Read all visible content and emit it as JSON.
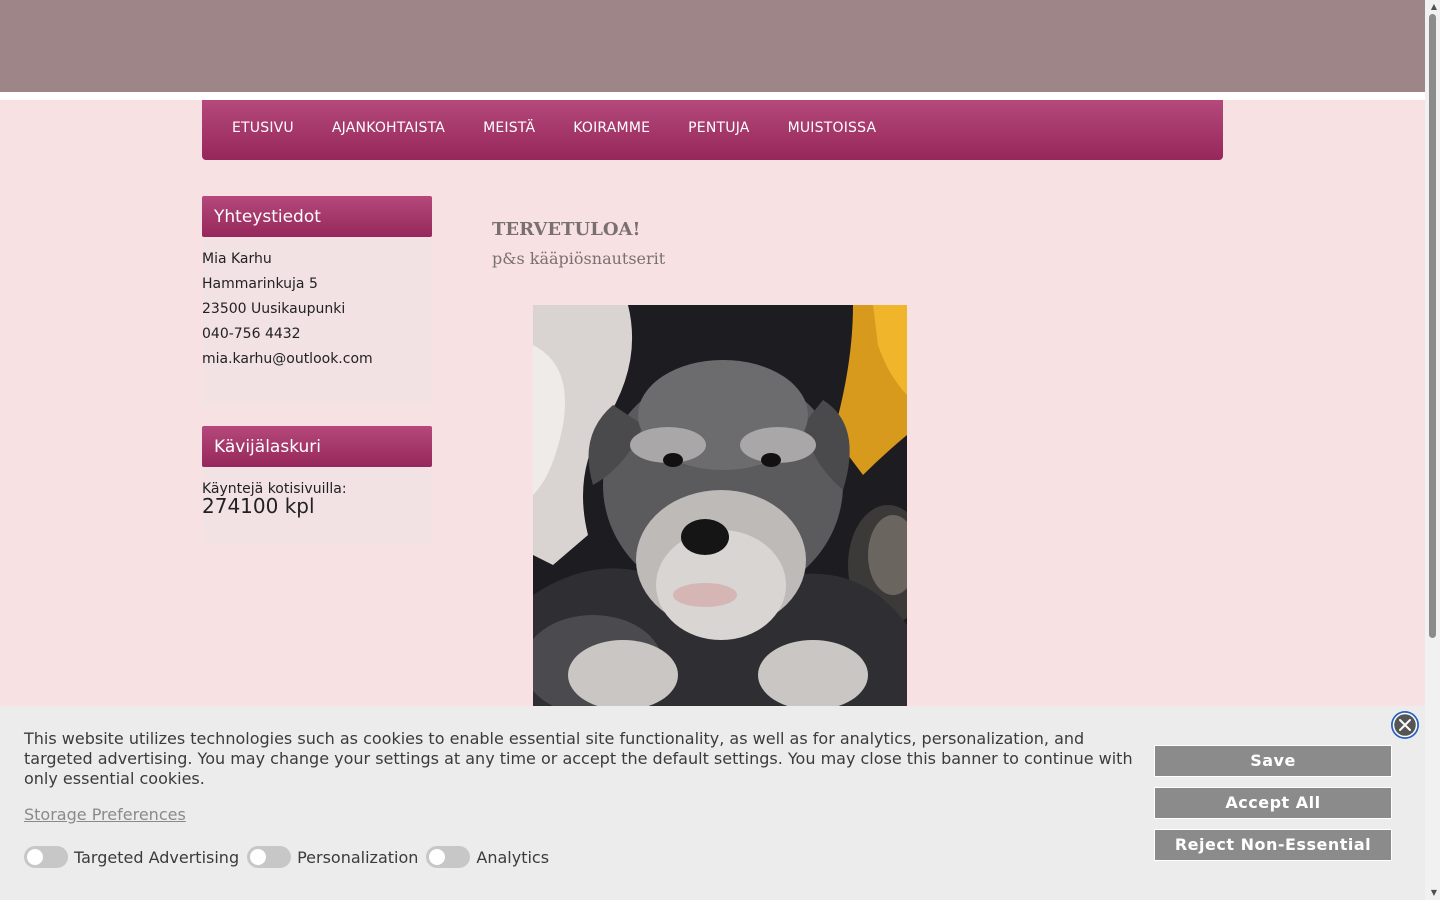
{
  "nav": {
    "items": [
      "ETUSIVU",
      "AJANKOHTAISTA",
      "MEISTÄ",
      "KOIRAMME",
      "PENTUJA",
      "MUISTOISSA"
    ]
  },
  "sidebar": {
    "contact": {
      "title": "Yhteystiedot",
      "name": "Mia Karhu",
      "street": "Hammarinkuja 5",
      "city": "23500 Uusikaupunki",
      "phone": "040-756 4432",
      "email": "mia.karhu@outlook.com"
    },
    "counter": {
      "title": "Kävijälaskuri",
      "label": "Käyntejä kotisivuilla:",
      "value": "274100 kpl"
    }
  },
  "main": {
    "title": "TERVETULOA!",
    "subtitle": "p&s kääpiösnautserit",
    "photo_icon": "schnauzer-puppy-photo"
  },
  "cookie_banner": {
    "text": "This website utilizes technologies such as cookies to enable essential site functionality, as well as for analytics, personalization, and targeted advertising. You may change your settings at any time or accept the default settings. You may close this banner to continue with only essential cookies.",
    "storage_link": "Storage Preferences",
    "toggles": [
      "Targeted Advertising",
      "Personalization",
      "Analytics"
    ],
    "buttons": {
      "save": "Save",
      "accept": "Accept All",
      "reject": "Reject Non-Essential"
    },
    "close_icon": "close-icon"
  },
  "colors": {
    "top_band": "#9e8688",
    "nav_gradient_top": "#b5497b",
    "nav_gradient_bottom": "#96275a",
    "page_bg": "#f7e1e3",
    "button_gray": "#8b8b8b"
  }
}
